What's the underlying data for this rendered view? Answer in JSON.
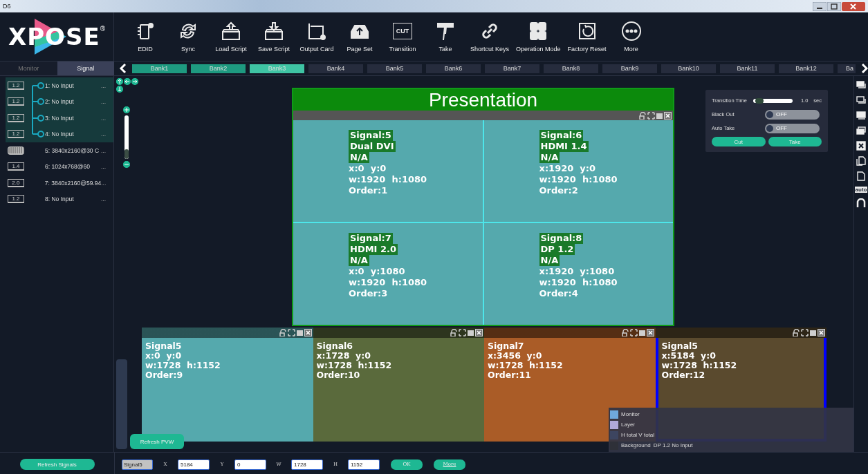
{
  "window": {
    "title": "D6"
  },
  "logo": {
    "text": "XPOSE",
    "mark": "®"
  },
  "toolbar": [
    {
      "label": "EDID"
    },
    {
      "label": "Sync"
    },
    {
      "label": "Load Script"
    },
    {
      "label": "Save Script"
    },
    {
      "label": "Output Card"
    },
    {
      "label": "Page Set"
    },
    {
      "label": "Transition",
      "icon_text": "CUT"
    },
    {
      "label": "Take"
    },
    {
      "label": "Shortcut Keys"
    },
    {
      "label": "Operation Mode"
    },
    {
      "label": "Factory Reset"
    },
    {
      "label": "More"
    }
  ],
  "sidebar": {
    "tabs": [
      {
        "label": "Monitor",
        "selected": false
      },
      {
        "label": "Signal",
        "selected": true
      }
    ],
    "signals": [
      {
        "port": "1.2",
        "kind": "dp",
        "label": "1: No Input",
        "grouped": true
      },
      {
        "port": "1.2",
        "kind": "dp",
        "label": "2: No Input",
        "grouped": true
      },
      {
        "port": "1.2",
        "kind": "dp",
        "label": "3: No Input",
        "grouped": true
      },
      {
        "port": "1.2",
        "kind": "dp",
        "label": "4: No Input",
        "grouped": true
      },
      {
        "kind": "dvi",
        "label": "5: 3840x2160@30 C",
        "grouped": false
      },
      {
        "port": "1.4",
        "kind": "hdmi",
        "label": "6: 1024x768@60",
        "grouped": false
      },
      {
        "port": "2.0",
        "kind": "hdmi",
        "label": "7: 3840x2160@59.94",
        "grouped": false
      },
      {
        "port": "1.2",
        "kind": "dp",
        "label": "8: No Input",
        "grouped": false
      }
    ],
    "more": "...",
    "refresh_button": "Refresh Signals"
  },
  "banks": [
    {
      "label": "Bank1",
      "used": true,
      "selected": false
    },
    {
      "label": "Bank2",
      "used": true,
      "selected": false
    },
    {
      "label": "Bank3",
      "used": true,
      "selected": true
    },
    {
      "label": "Bank4",
      "used": false,
      "selected": false
    },
    {
      "label": "Bank5",
      "used": false,
      "selected": false
    },
    {
      "label": "Bank6",
      "used": false,
      "selected": false
    },
    {
      "label": "Bank7",
      "used": false,
      "selected": false
    },
    {
      "label": "Bank8",
      "used": false,
      "selected": false
    },
    {
      "label": "Bank9",
      "used": false,
      "selected": false
    },
    {
      "label": "Bank10",
      "used": false,
      "selected": false
    },
    {
      "label": "Bank11",
      "used": false,
      "selected": false
    },
    {
      "label": "Bank12",
      "used": false,
      "selected": false
    },
    {
      "label": "Ba",
      "used": false,
      "selected": false
    }
  ],
  "zoom": {
    "level": 0.22
  },
  "presentation": {
    "title": "Presentation",
    "cells": [
      {
        "signal": "Signal:5",
        "type": "Dual DVI",
        "status": "N/A",
        "position": "x:0  y:0",
        "size": "w:1920  h:1080",
        "order": "Order:1"
      },
      {
        "signal": "Signal:6",
        "type": "HDMI 1.4",
        "status": "N/A",
        "position": "x:1920  y:0",
        "size": "w:1920  h:1080",
        "order": "Order:2"
      },
      {
        "signal": "Signal:7",
        "type": "HDMI 2.0",
        "status": "N/A",
        "position": "x:0  y:1080",
        "size": "w:1920  h:1080",
        "order": "Order:3"
      },
      {
        "signal": "Signal:8",
        "type": "DP 1.2",
        "status": "N/A",
        "position": "x:1920  y:1080",
        "size": "w:1920  h:1080",
        "order": "Order:4"
      }
    ]
  },
  "transition": {
    "time_label": "Transition Time",
    "level": 0.05,
    "reading": "1.0",
    "unit": "sec",
    "toggles": [
      {
        "label": "Black Out",
        "on": false,
        "text": "OFF"
      },
      {
        "label": "Auto Take",
        "on": false,
        "text": "OFF"
      }
    ],
    "buttons": [
      "Cut",
      "Take"
    ]
  },
  "layers": [
    {
      "name": "Signal5",
      "position": "x:0  y:0",
      "size": "w:1728  h:1152",
      "order": "Order:9",
      "color": "#55a9ad",
      "selected": false
    },
    {
      "name": "Signal6",
      "position": "x:1728  y:0",
      "size": "w:1728  h:1152",
      "order": "Order:10",
      "color": "#5a6a3c",
      "selected": false
    },
    {
      "name": "Signal7",
      "position": "x:3456  y:0",
      "size": "w:1728  h:1152",
      "order": "Order:11",
      "color": "#aa5c27",
      "selected": false
    },
    {
      "name": "Signal5",
      "position": "x:5184  y:0",
      "size": "w:1728  h:1152",
      "order": "Order:12",
      "color": "#5a4a2e",
      "selected": true
    }
  ],
  "legend": [
    {
      "label": "Monitor",
      "color": "#6fa8dc"
    },
    {
      "label": "Layer",
      "color": "#b0a8d8"
    },
    {
      "label": "H total V total",
      "color": "#3d4560"
    },
    {
      "label": "Background",
      "color": "#2e3038",
      "detail": "DP 1.2 No Input"
    }
  ],
  "refresh_pvw": "Refresh PVW",
  "rail": {
    "auto_label": "auto"
  },
  "properties": {
    "name": "Signal5",
    "fields": [
      {
        "label": "X",
        "value": "5184"
      },
      {
        "label": "Y",
        "value": "0"
      },
      {
        "label": "W",
        "value": "1728"
      },
      {
        "label": "H",
        "value": "1152"
      }
    ],
    "buttons": [
      "OK",
      "More"
    ]
  }
}
